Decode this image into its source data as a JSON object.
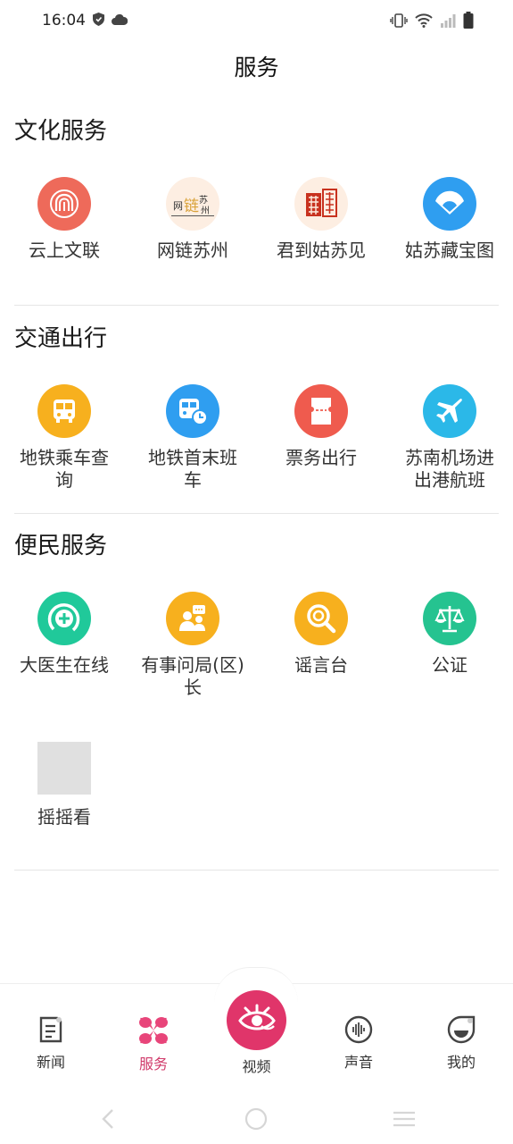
{
  "status_bar": {
    "time": "16:04"
  },
  "header": {
    "title": "服务"
  },
  "sections": [
    {
      "title": "文化服务",
      "items": [
        {
          "label": "云上文联",
          "icon": "pavilion-icon",
          "color": "#ee6a5a"
        },
        {
          "label": "网链苏州",
          "icon": "wanglian-logo-icon",
          "color": "#fdeee2"
        },
        {
          "label": "君到姑苏见",
          "icon": "red-seal-icon",
          "color": "#fdeee2"
        },
        {
          "label": "姑苏藏宝图",
          "icon": "fan-icon",
          "color": "#2f9ef0"
        }
      ]
    },
    {
      "title": "交通出行",
      "items": [
        {
          "label": "地铁乘车查询",
          "icon": "bus-icon",
          "color": "#f7b01e"
        },
        {
          "label": "地铁首末班车",
          "icon": "bus-clock-icon",
          "color": "#2f9ef0"
        },
        {
          "label": "票务出行",
          "icon": "ticket-icon",
          "color": "#ef5b4e"
        },
        {
          "label": "苏南机场进出港航班",
          "icon": "airplane-icon",
          "color": "#2bb8e8"
        }
      ]
    },
    {
      "title": "便民服务",
      "items": [
        {
          "label": "大医生在线",
          "icon": "medical-plus-icon",
          "color": "#20c99a"
        },
        {
          "label": "有事问局(区)长",
          "icon": "people-chat-icon",
          "color": "#f7b01e"
        },
        {
          "label": "谣言台",
          "icon": "magnifier-icon",
          "color": "#f7b01e"
        },
        {
          "label": "公证",
          "icon": "scales-icon",
          "color": "#25c390"
        },
        {
          "label": "摇摇看",
          "icon": "placeholder-image-icon",
          "color": "#e0e0e0"
        }
      ]
    }
  ],
  "bottom_nav": {
    "items": [
      {
        "label": "新闻",
        "icon": "news-icon"
      },
      {
        "label": "服务",
        "icon": "flower-icon",
        "active": true
      },
      {
        "label": "视频",
        "icon": "video-eye-icon"
      },
      {
        "label": "声音",
        "icon": "sound-wave-icon"
      },
      {
        "label": "我的",
        "icon": "profile-icon"
      }
    ]
  },
  "colors": {
    "accent": "#d03a6a",
    "video_button": "#e0356a"
  }
}
